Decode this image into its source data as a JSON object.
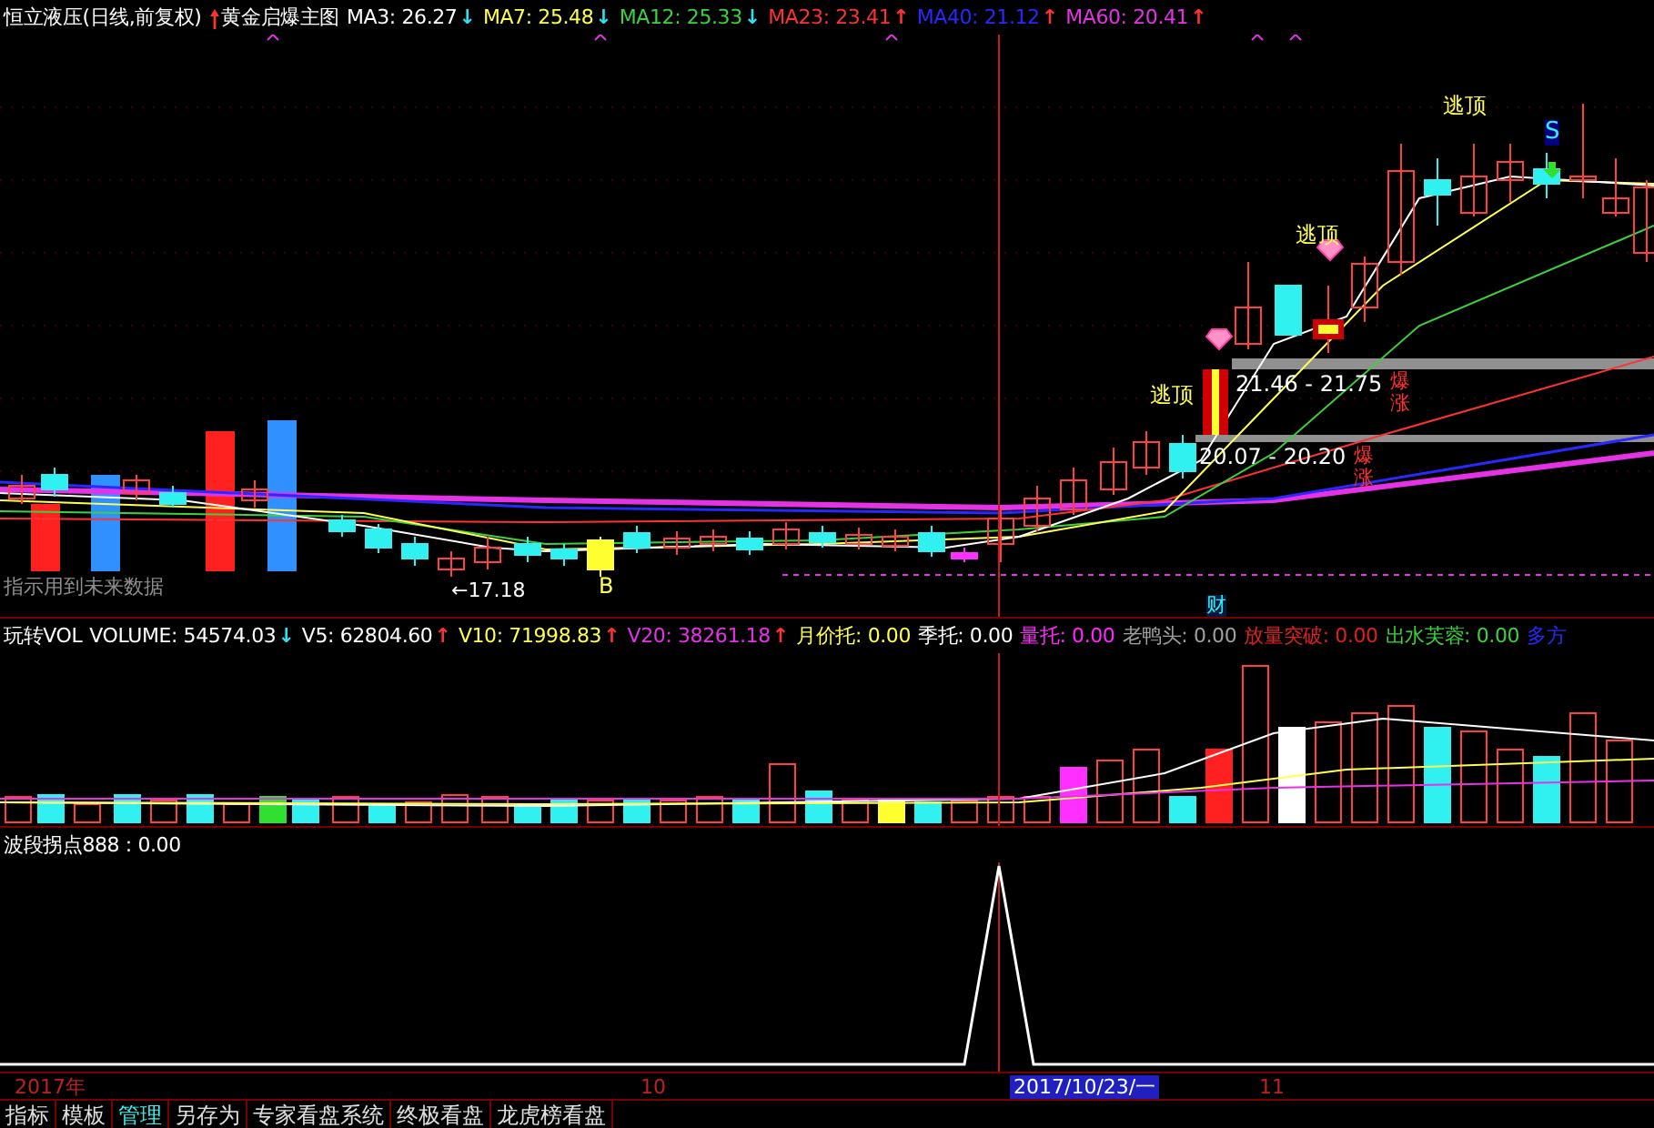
{
  "main_panel": {
    "title": "恒立液压(日线,前复权)",
    "formula": "黄金启爆主图",
    "indicators": [
      {
        "text": "MA3: 26.27",
        "color": "#ffffff",
        "arrow": "↓",
        "rising": false
      },
      {
        "text": "MA7: 25.48",
        "color": "#ffff54",
        "arrow": "↓",
        "rising": false
      },
      {
        "text": "MA12: 25.33",
        "color": "#3cd23c",
        "arrow": "↓",
        "rising": false
      },
      {
        "text": "MA23: 23.41",
        "color": "#ff3232",
        "arrow": "↑",
        "rising": true
      },
      {
        "text": "MA40: 21.12",
        "color": "#2828ff",
        "arrow": "↑",
        "rising": true
      },
      {
        "text": "MA60: 20.41",
        "color": "#e632e6",
        "arrow": "↑",
        "rising": true
      }
    ],
    "annotations": [
      {
        "kind": "escape",
        "text": "逃顶"
      },
      {
        "kind": "sell",
        "text": "S"
      },
      {
        "kind": "escape",
        "text": "逃顶"
      },
      {
        "kind": "escape",
        "text": "逃顶"
      },
      {
        "kind": "range",
        "text": "21.46 - 21.75"
      },
      {
        "kind": "surge",
        "text": "爆涨"
      },
      {
        "kind": "range",
        "text": "20.07 - 20.20"
      },
      {
        "kind": "surge",
        "text": "爆涨"
      },
      {
        "kind": "note",
        "text": "指示用到未来数据"
      },
      {
        "kind": "low",
        "text": "←17.18"
      },
      {
        "kind": "buy",
        "text": "B"
      },
      {
        "kind": "finance",
        "text": "财"
      }
    ]
  },
  "volume_panel": {
    "title": "玩转VOL",
    "indicators": [
      {
        "text": "VOLUME: 54574.03",
        "color": "#ffffff",
        "arrow": "↓",
        "rising": false
      },
      {
        "text": "V5: 62804.60",
        "color": "#ffffff",
        "arrow": "↑",
        "rising": true
      },
      {
        "text": "V10: 71998.83",
        "color": "#ffff54",
        "arrow": "↑",
        "rising": true
      },
      {
        "text": "V20: 38261.18",
        "color": "#e632e6",
        "arrow": "↑",
        "rising": true
      },
      {
        "text": "月价托: 0.00",
        "color": "#ffff54"
      },
      {
        "text": "季托: 0.00",
        "color": "#ffffff"
      },
      {
        "text": "量托: 0.00",
        "color": "#ff28ff"
      },
      {
        "text": "老鸭头: 0.00",
        "color": "#a0a0a0"
      },
      {
        "text": "放量突破: 0.00",
        "color": "#e02020"
      },
      {
        "text": "出水芙蓉: 0.00",
        "color": "#3cd23c"
      },
      {
        "text": "多方",
        "color": "#2828ff"
      }
    ]
  },
  "wave_panel": {
    "title": "波段拐点888 : 0.00"
  },
  "date_axis": [
    {
      "text": "2017年",
      "selected": false
    },
    {
      "text": "10",
      "selected": false
    },
    {
      "text": "2017/10/23/一",
      "selected": true
    },
    {
      "text": "11",
      "selected": false
    }
  ],
  "bottom_tabs": [
    {
      "label": "指标",
      "selected": false
    },
    {
      "label": "模板",
      "selected": false
    },
    {
      "label": "管理",
      "selected": true
    },
    {
      "label": "另存为",
      "selected": false
    },
    {
      "label": "专家看盘系统",
      "selected": false
    },
    {
      "label": "终极看盘",
      "selected": false
    },
    {
      "label": "龙虎榜看盘",
      "selected": false
    }
  ]
}
